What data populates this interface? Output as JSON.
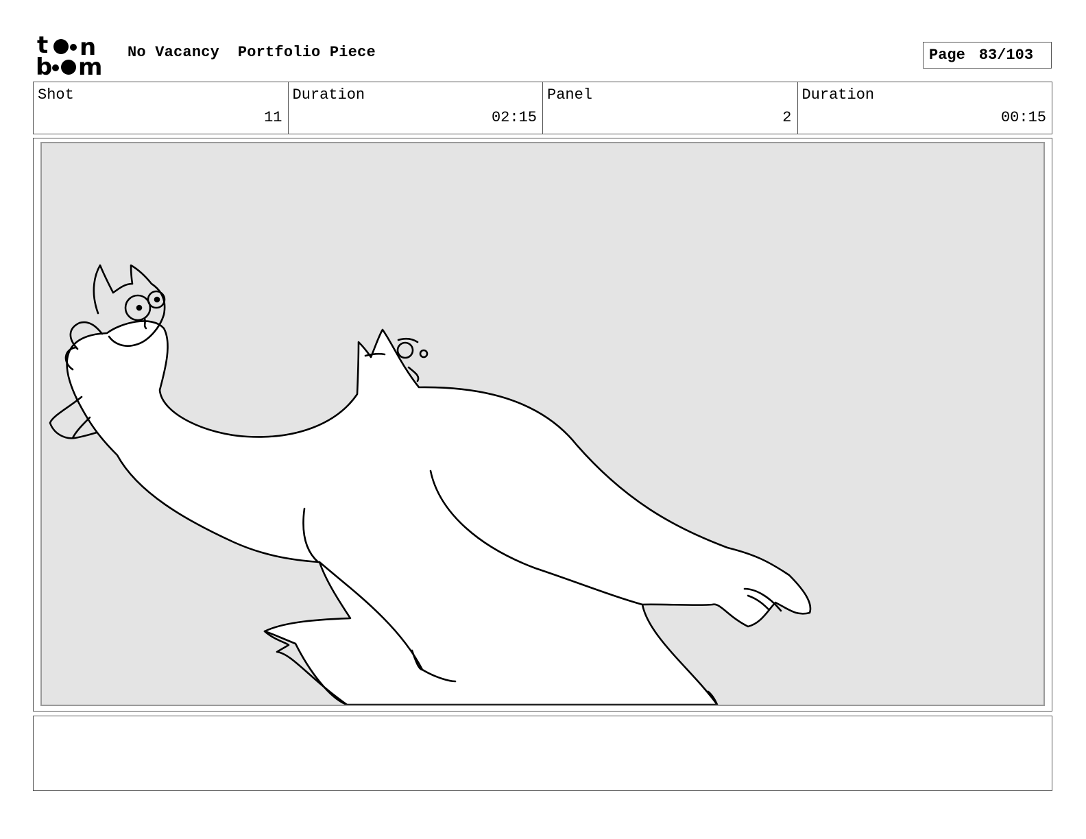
{
  "header": {
    "logo_text": "toon boom",
    "project_title": "No Vacancy  Portfolio Piece",
    "page_label": "Page",
    "page_value": "83/103"
  },
  "info": {
    "shot_label": "Shot",
    "shot_value": "11",
    "shot_duration_label": "Duration",
    "shot_duration_value": "02:15",
    "panel_label": "Panel",
    "panel_value": "2",
    "panel_duration_label": "Duration",
    "panel_duration_value": "00:15"
  },
  "panel": {
    "background_color": "#e4e4e4",
    "line_color": "#000000",
    "fill_color": "#ffffff"
  },
  "notes": {
    "text": ""
  }
}
